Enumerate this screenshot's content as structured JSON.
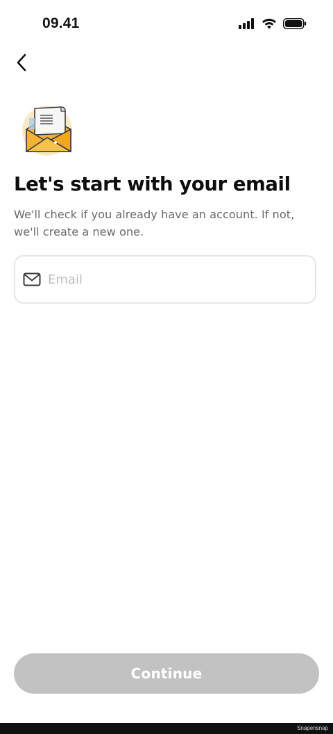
{
  "status_bar": {
    "time": "09.41",
    "icons": [
      "cellular-signal-icon",
      "wifi-icon",
      "battery-icon"
    ]
  },
  "nav": {
    "back_icon": "chevron-left-icon"
  },
  "illustration": {
    "icon": "envelope-letter-illustration"
  },
  "content": {
    "headline": "Let's start with your email",
    "subtext": "We'll check if you already have an account. If not, we'll create a new one."
  },
  "email_field": {
    "icon": "mail-icon",
    "placeholder": "Email",
    "value": ""
  },
  "footer": {
    "continue_label": "Continue",
    "watermark": "Snapensnap"
  },
  "colors": {
    "button_disabled": "#c2c2c2",
    "field_border": "#e6e6e6",
    "placeholder": "#bdbdbd",
    "subtext": "#6b6b6b",
    "illustration_accent": "#f5b335"
  }
}
